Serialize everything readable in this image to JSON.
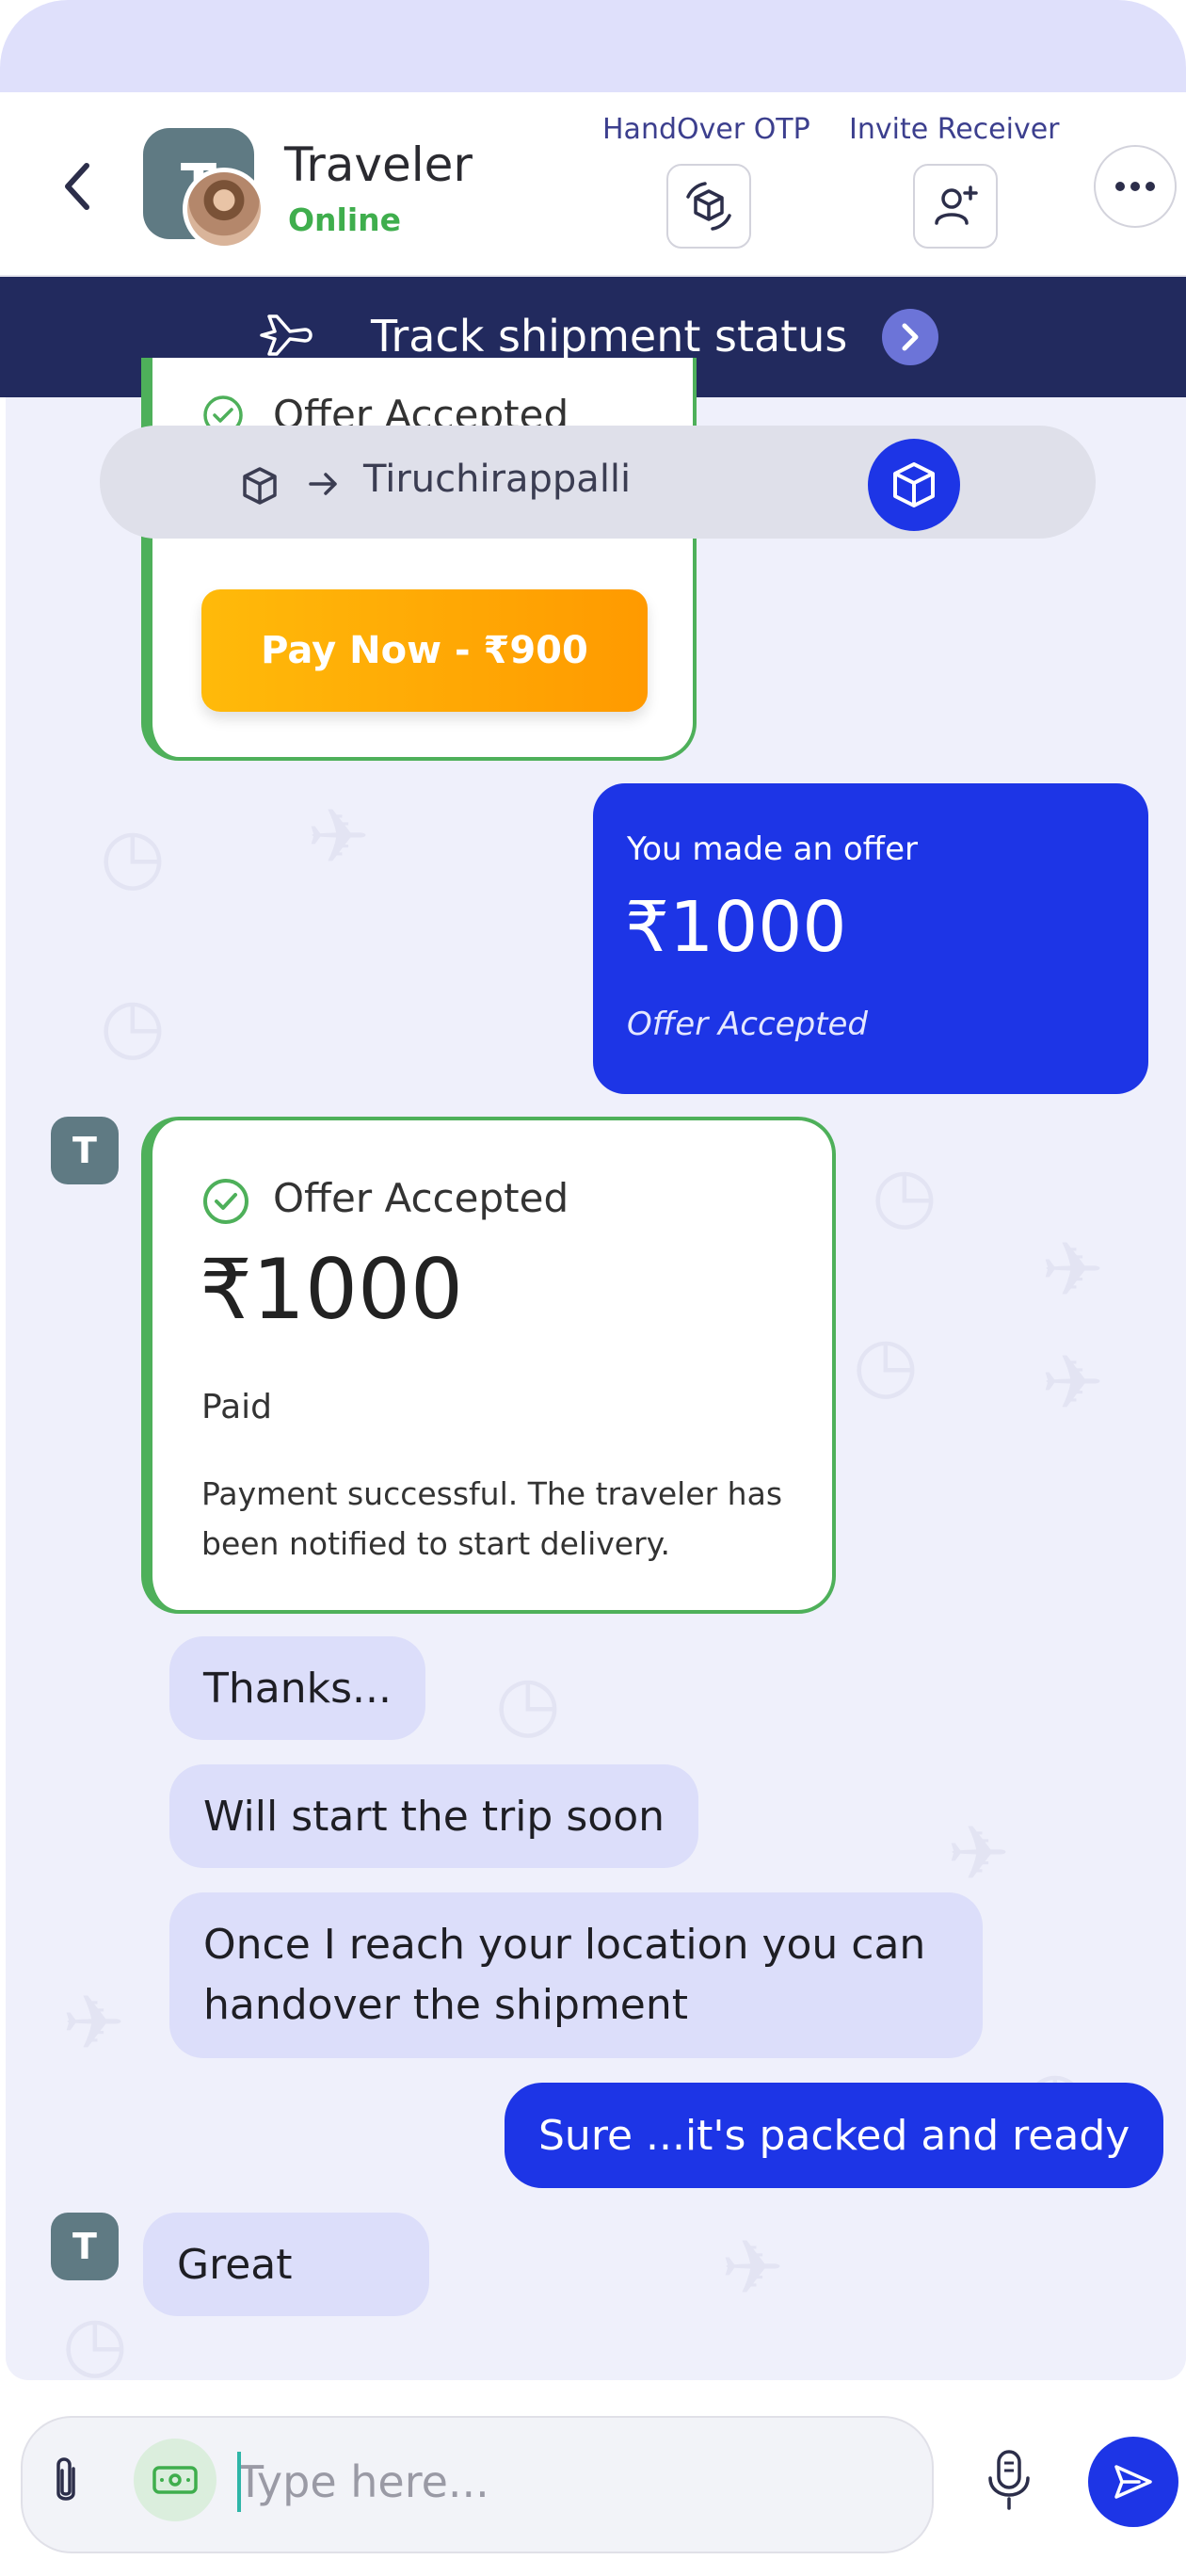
{
  "header": {
    "back_icon": "chevron-left-icon",
    "avatar_initial": "T",
    "contact_name": "Traveler",
    "contact_status": "Online",
    "handover_label": "HandOver OTP",
    "invite_label": "Invite Receiver",
    "more_icon": "more-horizontal-icon"
  },
  "track_bar": {
    "text": "Track shipment status"
  },
  "route": {
    "city": "Tiruchirappalli"
  },
  "chat": {
    "top_card": {
      "title": "Offer Accepted",
      "pay_button": "Pay Now - ₹900"
    },
    "offer_bubble": {
      "label": "You made an offer",
      "amount": "₹1000",
      "status": "Offer Accepted"
    },
    "main_card": {
      "avatar_initial": "T",
      "title": "Offer Accepted",
      "amount": "₹1000",
      "payment_state": "Paid",
      "description": "Payment successful. The traveler has been notified to start delivery."
    },
    "messages": [
      {
        "text": "Thanks..."
      },
      {
        "text": "Will start the trip soon"
      },
      {
        "text": "Once I reach your location you can handover the shipment"
      },
      {
        "text": "Sure ...it's packed and ready"
      },
      {
        "text": "Great"
      }
    ],
    "last_avatar_initial": "T"
  },
  "composer": {
    "placeholder": "Type here..."
  },
  "colors": {
    "accent_blue": "#1d35e6",
    "navy": "#222a5e",
    "green": "#4eb05a",
    "pay_orange": "#ff9a00",
    "bubble_in": "#dcdefa"
  }
}
